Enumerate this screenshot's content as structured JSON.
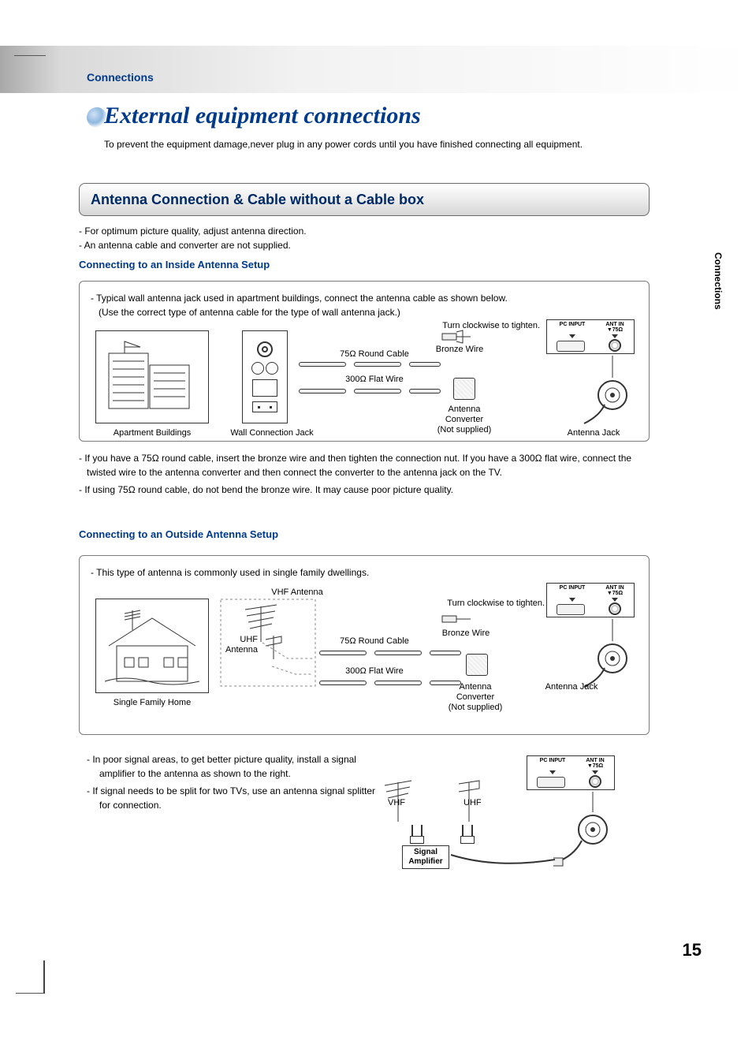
{
  "header": {
    "section_label": "Connections",
    "title": "External equipment connections",
    "subtitle": "To prevent the equipment damage,never plug in any power cords until you have finished connecting all equipment."
  },
  "side_tab": "Connections",
  "section_band": "Antenna Connection & Cable without a Cable box",
  "intro_notes": {
    "n1": "- For optimum picture quality, adjust antenna direction.",
    "n2": "- An antenna cable and converter are not supplied."
  },
  "inside": {
    "heading": "Connecting to an Inside Antenna Setup",
    "frame_note_l1": "-  Typical wall antenna jack used in apartment buildings, connect the antenna cable as shown below.",
    "frame_note_l2": "(Use the correct type of antenna cable for the type of wall antenna jack.)",
    "labels": {
      "apartment": "Apartment Buildings",
      "wall_jack": "Wall Connection Jack",
      "tighten": "Turn clockwise to tighten.",
      "round75": "75Ω Round Cable",
      "flat300": "300Ω Flat Wire",
      "bronze": "Bronze Wire",
      "converter_l1": "Antenna",
      "converter_l2": "Converter",
      "converter_l3": "(Not supplied)",
      "antenna_jack": "Antenna Jack",
      "pc_input": "PC INPUT",
      "ant_in_l1": "ANT IN",
      "ant_in_l2": "▼75Ω"
    },
    "post_notes": {
      "p1": "- If you have a 75Ω round cable, insert the bronze wire and then tighten the connection nut. If you have a 300Ω flat wire, connect the twisted wire to the antenna converter and then connect the converter to the antenna jack on the TV.",
      "p2": "- If using 75Ω round cable, do not bend the bronze wire. It may cause poor picture quality."
    }
  },
  "outside": {
    "heading": "Connecting to an Outside Antenna Setup",
    "frame_note": "-  This type of antenna is commonly used in single family dwellings.",
    "labels": {
      "single_home": "Single Family Home",
      "vhf_ant": "VHF Antenna",
      "uhf_ant": "UHF",
      "uhf_ant2": "Antenna",
      "tighten": "Turn clockwise to tighten.",
      "round75": "75Ω Round Cable",
      "flat300": "300Ω Flat Wire",
      "bronze": "Bronze Wire",
      "converter_l1": "Antenna",
      "converter_l2": "Converter",
      "converter_l3": "(Not supplied)",
      "antenna_jack": "Antenna Jack",
      "pc_input": "PC INPUT",
      "ant_in_l1": "ANT IN",
      "ant_in_l2": "▼75Ω"
    },
    "tips": {
      "t1": "-   In poor signal areas, to get better picture quality, install a signal amplifier to the antenna as shown to the right.",
      "t2": "-   If signal needs to be split for two TVs, use an antenna signal splitter for connection."
    },
    "amp": {
      "vhf": "VHF",
      "uhf": "UHF",
      "label_l1": "Signal",
      "label_l2": "Amplifier",
      "pc_input": "PC INPUT",
      "ant_in_l1": "ANT IN",
      "ant_in_l2": "▼75Ω"
    }
  },
  "page_number": "15"
}
